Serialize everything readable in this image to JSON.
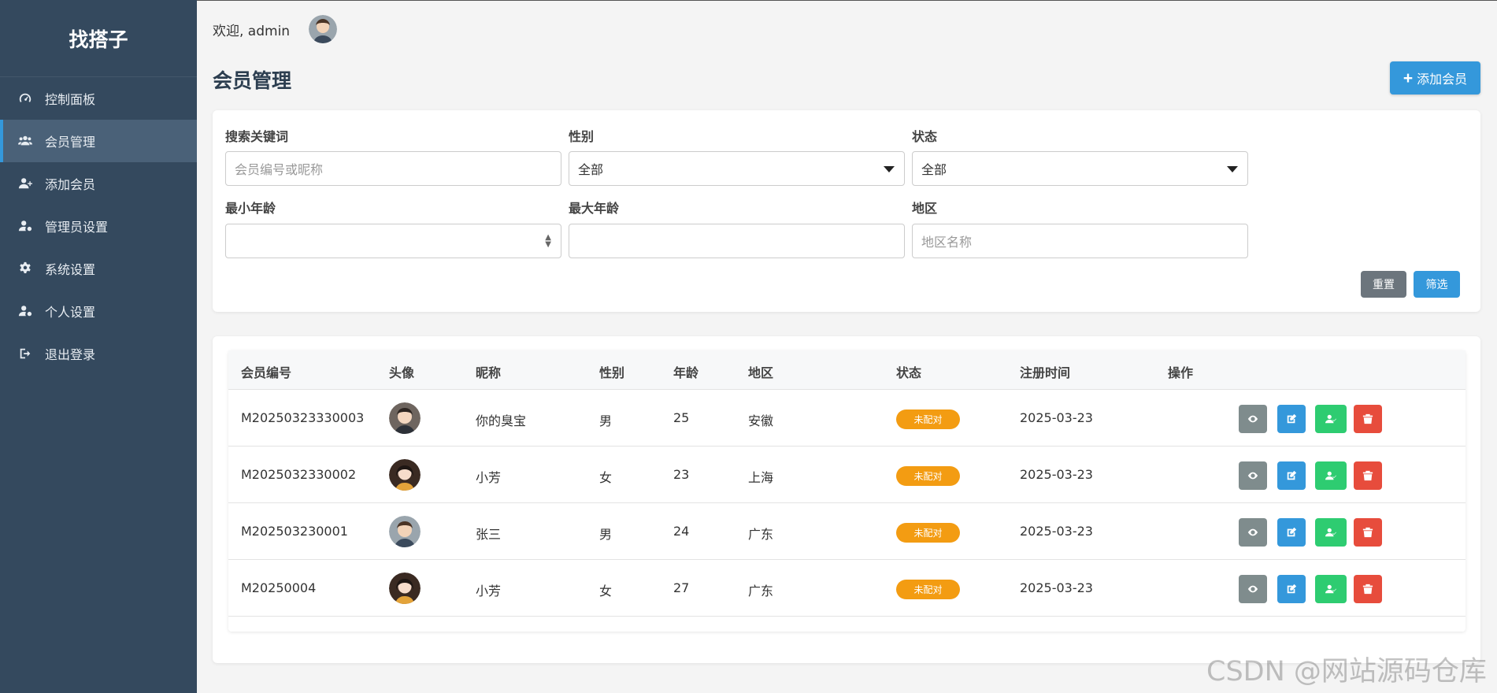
{
  "sidebar": {
    "brand": "找搭子",
    "items": [
      {
        "label": "控制面板",
        "icon": "dashboard-icon"
      },
      {
        "label": "会员管理",
        "icon": "users-icon"
      },
      {
        "label": "添加会员",
        "icon": "user-plus-icon"
      },
      {
        "label": "管理员设置",
        "icon": "user-cog-icon"
      },
      {
        "label": "系统设置",
        "icon": "gear-icon"
      },
      {
        "label": "个人设置",
        "icon": "user-gear-icon"
      },
      {
        "label": "退出登录",
        "icon": "logout-icon"
      }
    ],
    "active_index": 1
  },
  "header": {
    "welcome": "欢迎, admin",
    "page_title": "会员管理",
    "add_button": "添加会员"
  },
  "filters": {
    "keyword_label": "搜索关键词",
    "keyword_placeholder": "会员编号或昵称",
    "gender_label": "性别",
    "gender_value": "全部",
    "status_label": "状态",
    "status_value": "全部",
    "min_age_label": "最小年龄",
    "max_age_label": "最大年龄",
    "region_label": "地区",
    "region_placeholder": "地区名称",
    "reset_button": "重置",
    "filter_button": "筛选"
  },
  "table": {
    "headers": [
      "会员编号",
      "头像",
      "昵称",
      "性别",
      "年龄",
      "地区",
      "状态",
      "注册时间",
      "操作"
    ],
    "rows": [
      {
        "id": "M20250323330003",
        "nickname": "你的臭宝",
        "gender": "男",
        "age": "25",
        "region": "安徽",
        "status": "未配对",
        "registered": "2025-03-23",
        "avatar": "male"
      },
      {
        "id": "M2025032330002",
        "nickname": "小芳",
        "gender": "女",
        "age": "23",
        "region": "上海",
        "status": "未配对",
        "registered": "2025-03-23",
        "avatar": "female"
      },
      {
        "id": "M202503230001",
        "nickname": "张三",
        "gender": "男",
        "age": "24",
        "region": "广东",
        "status": "未配对",
        "registered": "2025-03-23",
        "avatar": "male"
      },
      {
        "id": "M20250004",
        "nickname": "小芳",
        "gender": "女",
        "age": "27",
        "region": "广东",
        "status": "未配对",
        "registered": "2025-03-23",
        "avatar": "female"
      }
    ]
  },
  "watermark": "CSDN @网站源码仓库",
  "colors": {
    "sidebar_bg": "#34495e",
    "primary": "#3498db",
    "status_badge": "#f39c12",
    "view": "#7f8c8d",
    "match": "#2ecc71",
    "delete": "#e74c3c"
  }
}
